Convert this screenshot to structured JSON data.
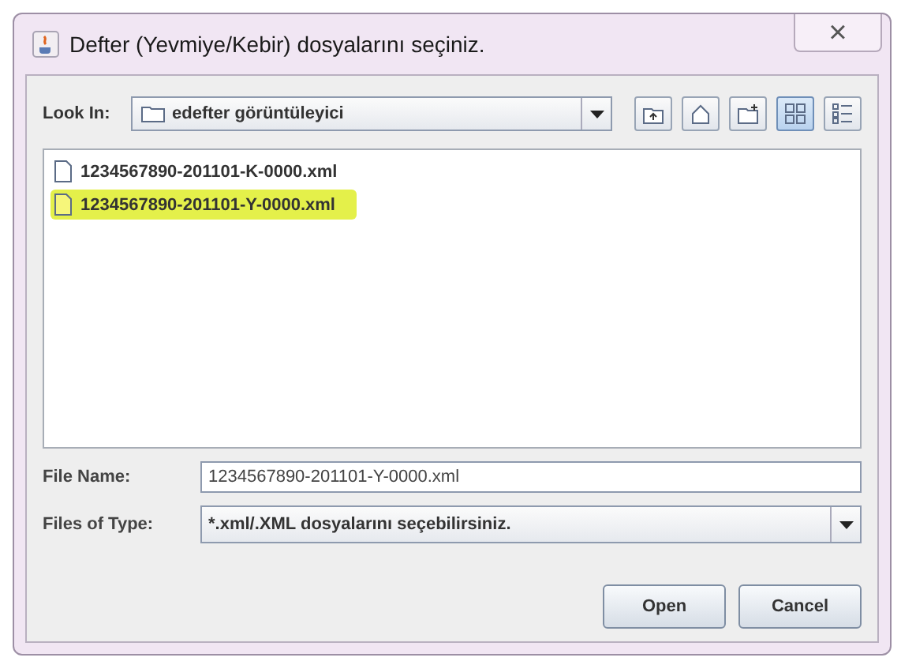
{
  "window": {
    "title": "Defter (Yevmiye/Kebir) dosyalarını seçiniz.",
    "close": "×"
  },
  "look_in": {
    "label": "Look In:",
    "value": "edefter görüntüleyici"
  },
  "files": [
    {
      "name": "1234567890-201101-K-0000.xml",
      "selected": false
    },
    {
      "name": "1234567890-201101-Y-0000.xml",
      "selected": true
    }
  ],
  "toolbar": [
    {
      "kind": "up"
    },
    {
      "kind": "home"
    },
    {
      "kind": "newfolder"
    },
    {
      "kind": "list",
      "selected": true
    },
    {
      "kind": "details",
      "selected": false
    }
  ],
  "file_name": {
    "label": "File Name:",
    "value": "1234567890-201101-Y-0000.xml"
  },
  "file_type": {
    "label": "Files of Type:",
    "value": "*.xml/.XML dosyalarını seçebilirsiniz."
  },
  "buttons": [
    "Open",
    "Cancel"
  ]
}
